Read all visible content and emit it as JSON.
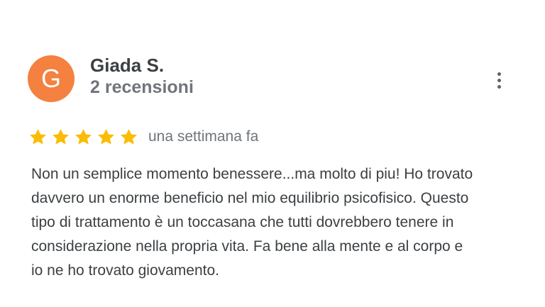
{
  "review": {
    "avatar_letter": "G",
    "avatar_color": "#f4813f",
    "reviewer_name": "Giada S.",
    "review_count": "2 recensioni",
    "rating": 5,
    "rating_max": 5,
    "star_color": "#fbbc04",
    "date": "una settimana fa",
    "text_lines": [
      "Non un semplice momento benessere...ma molto di piu! Ho trovato",
      "davvero un enorme beneficio nel mio equilibrio psicofisico. Questo",
      "tipo di trattamento è un toccasana che tutti dovrebbero tenere in",
      "considerazione nella propria vita. Fa bene alla mente e al corpo e",
      "io ne ho trovato giovamento."
    ],
    "more_icon": "more-vertical-icon"
  }
}
